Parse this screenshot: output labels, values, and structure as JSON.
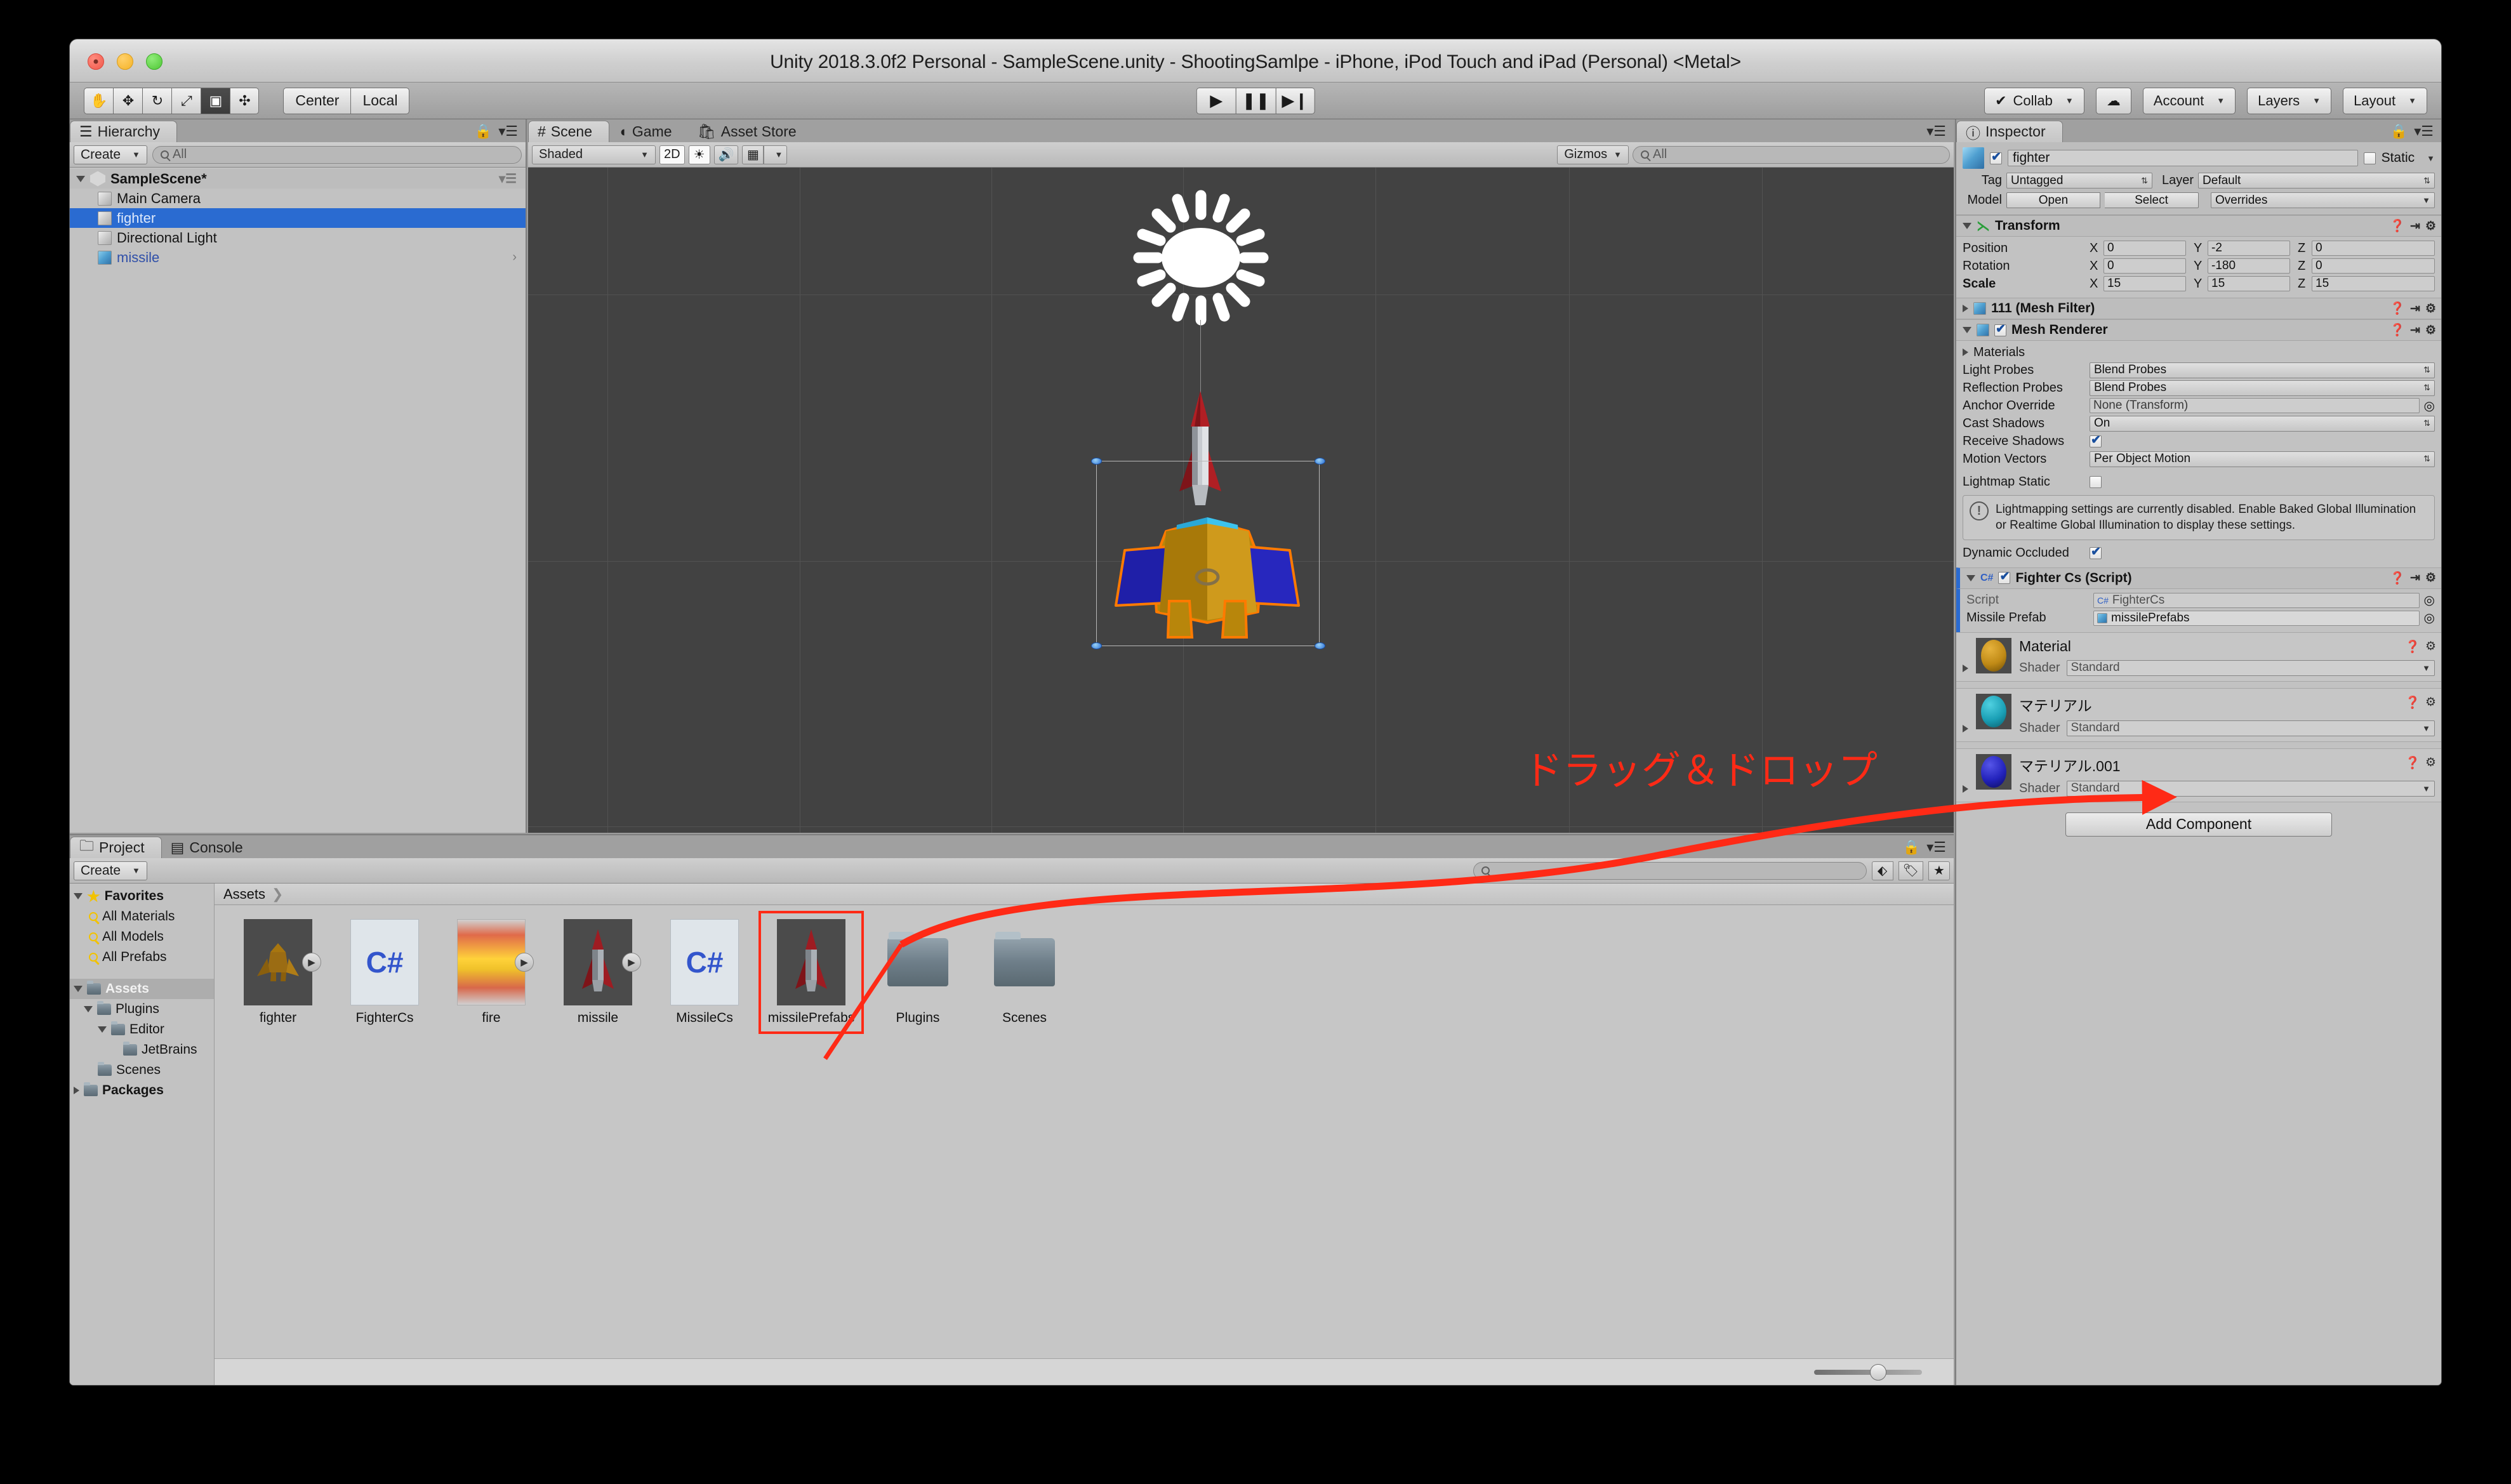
{
  "window": {
    "title": "Unity 2018.3.0f2 Personal - SampleScene.unity - ShootingSamlpe - iPhone, iPod Touch and iPad (Personal) <Metal>"
  },
  "toolbar": {
    "tools": [
      {
        "name": "hand-tool",
        "glyph": "✋"
      },
      {
        "name": "move-tool",
        "glyph": "✥"
      },
      {
        "name": "rotate-tool",
        "glyph": "↻"
      },
      {
        "name": "scale-tool",
        "glyph": "⤢"
      },
      {
        "name": "rect-tool",
        "glyph": "▣"
      },
      {
        "name": "transform-tool",
        "glyph": "✣"
      }
    ],
    "pivot_mode": "Center",
    "pivot_rotation": "Local",
    "play": "▶",
    "pause": "❚❚",
    "step": "▶❙",
    "collab": "Collab",
    "cloud": "☁",
    "account": "Account",
    "layers": "Layers",
    "layout": "Layout"
  },
  "hierarchy": {
    "tab": "Hierarchy",
    "create_label": "Create",
    "search_placeholder": "All",
    "scene_name": "SampleScene*",
    "items": [
      {
        "label": "Main Camera",
        "selected": false,
        "icon": "cube-gray",
        "has_children": false
      },
      {
        "label": "fighter",
        "selected": true,
        "icon": "cube-gray",
        "has_children": false
      },
      {
        "label": "Directional Light",
        "selected": false,
        "icon": "cube-gray",
        "has_children": false
      },
      {
        "label": "missile",
        "selected": false,
        "icon": "cube-blue",
        "has_children": true
      }
    ]
  },
  "scene": {
    "tabs": [
      {
        "label": "Scene",
        "icon": "grid-icon",
        "selected": true
      },
      {
        "label": "Game",
        "icon": "gamepad-icon",
        "selected": false
      },
      {
        "label": "Asset Store",
        "icon": "store-icon",
        "selected": false
      }
    ],
    "draw_mode": "Shaded",
    "two_d": "2D",
    "lighting_icon": "☀",
    "audio_icon": "🔊",
    "fx_icon": "▦",
    "gizmos_label": "Gizmos",
    "search_placeholder": "All",
    "annotation": "ドラッグ＆ドロップ",
    "annotation_color": "#ff2a16"
  },
  "inspector": {
    "tab": "Inspector",
    "object_name": "fighter",
    "enabled": true,
    "static_label": "Static",
    "tag_label": "Tag",
    "tag_value": "Untagged",
    "layer_label": "Layer",
    "layer_value": "Default",
    "model_label": "Model",
    "open_label": "Open",
    "select_label": "Select",
    "overrides_label": "Overrides",
    "transform": {
      "title": "Transform",
      "rows": [
        {
          "label": "Position",
          "x": "0",
          "y": "-2",
          "z": "0"
        },
        {
          "label": "Rotation",
          "x": "0",
          "y": "-180",
          "z": "0"
        },
        {
          "label": "Scale",
          "x": "15",
          "y": "15",
          "z": "15"
        }
      ]
    },
    "mesh_filter": {
      "title": "111 (Mesh Filter)"
    },
    "mesh_renderer": {
      "title": "Mesh Renderer",
      "enabled": true,
      "materials_label": "Materials",
      "props": [
        {
          "label": "Light Probes",
          "type": "dropdown",
          "value": "Blend Probes"
        },
        {
          "label": "Reflection Probes",
          "type": "dropdown",
          "value": "Blend Probes"
        },
        {
          "label": "Anchor Override",
          "type": "object",
          "value": "None (Transform)"
        },
        {
          "label": "Cast Shadows",
          "type": "dropdown",
          "value": "On"
        },
        {
          "label": "Receive Shadows",
          "type": "checkbox",
          "value": true
        },
        {
          "label": "Motion Vectors",
          "type": "dropdown",
          "value": "Per Object Motion"
        },
        {
          "label": "Lightmap Static",
          "type": "checkbox",
          "value": false
        }
      ],
      "helpbox": "Lightmapping settings are currently disabled. Enable Baked Global Illumination or Realtime Global Illumination to display these settings.",
      "dynamic_occluded_label": "Dynamic Occluded",
      "dynamic_occluded_value": true
    },
    "script_component": {
      "title": "Fighter Cs (Script)",
      "enabled": true,
      "script_label": "Script",
      "script_value": "FighterCs",
      "missile_label": "Missile Prefab",
      "missile_value": "missilePrefabs"
    },
    "materials": [
      {
        "name": "Material",
        "shader_label": "Shader",
        "shader_value": "Standard",
        "color": "#c08a16"
      },
      {
        "name": "マテリアル",
        "shader_label": "Shader",
        "shader_value": "Standard",
        "color": "#1a9fb5"
      },
      {
        "name": "マテリアル.001",
        "shader_label": "Shader",
        "shader_value": "Standard",
        "color": "#2222bb"
      }
    ],
    "add_component": "Add Component"
  },
  "project": {
    "tabs": [
      {
        "label": "Project",
        "icon": "folder-icon",
        "selected": true
      },
      {
        "label": "Console",
        "icon": "console-icon",
        "selected": false
      }
    ],
    "create_label": "Create",
    "search_placeholder": "",
    "breadcrumb": "Assets",
    "tree": [
      {
        "label": "Favorites",
        "depth": 0,
        "kind": "star",
        "expanded": true,
        "bold": true
      },
      {
        "label": "All Materials",
        "depth": 1,
        "kind": "search",
        "expanded": false,
        "bold": false
      },
      {
        "label": "All Models",
        "depth": 1,
        "kind": "search",
        "expanded": false,
        "bold": false
      },
      {
        "label": "All Prefabs",
        "depth": 1,
        "kind": "search",
        "expanded": false,
        "bold": false
      },
      {
        "label": "Assets",
        "depth": 0,
        "kind": "folder",
        "expanded": true,
        "bold": true,
        "selected": true
      },
      {
        "label": "Plugins",
        "depth": 1,
        "kind": "folder",
        "expanded": true,
        "bold": false
      },
      {
        "label": "Editor",
        "depth": 2,
        "kind": "folder",
        "expanded": true,
        "bold": false
      },
      {
        "label": "JetBrains",
        "depth": 3,
        "kind": "folder",
        "expanded": false,
        "bold": false
      },
      {
        "label": "Scenes",
        "depth": 1,
        "kind": "folder",
        "expanded": false,
        "bold": false
      },
      {
        "label": "Packages",
        "depth": 0,
        "kind": "folder",
        "expanded": false,
        "bold": true
      }
    ],
    "assets": [
      {
        "label": "fighter",
        "kind": "model",
        "color": "#9b6c13",
        "highlighted": false
      },
      {
        "label": "FighterCs",
        "kind": "script",
        "glyph": "C#",
        "highlighted": false
      },
      {
        "label": "fire",
        "kind": "texture",
        "highlighted": false
      },
      {
        "label": "missile",
        "kind": "model-missile",
        "highlighted": false
      },
      {
        "label": "MissileCs",
        "kind": "script",
        "glyph": "C#",
        "highlighted": false
      },
      {
        "label": "missilePrefabs",
        "kind": "model-missile",
        "highlighted": true
      },
      {
        "label": "Plugins",
        "kind": "folder",
        "highlighted": false
      },
      {
        "label": "Scenes",
        "kind": "folder",
        "highlighted": false
      }
    ]
  }
}
